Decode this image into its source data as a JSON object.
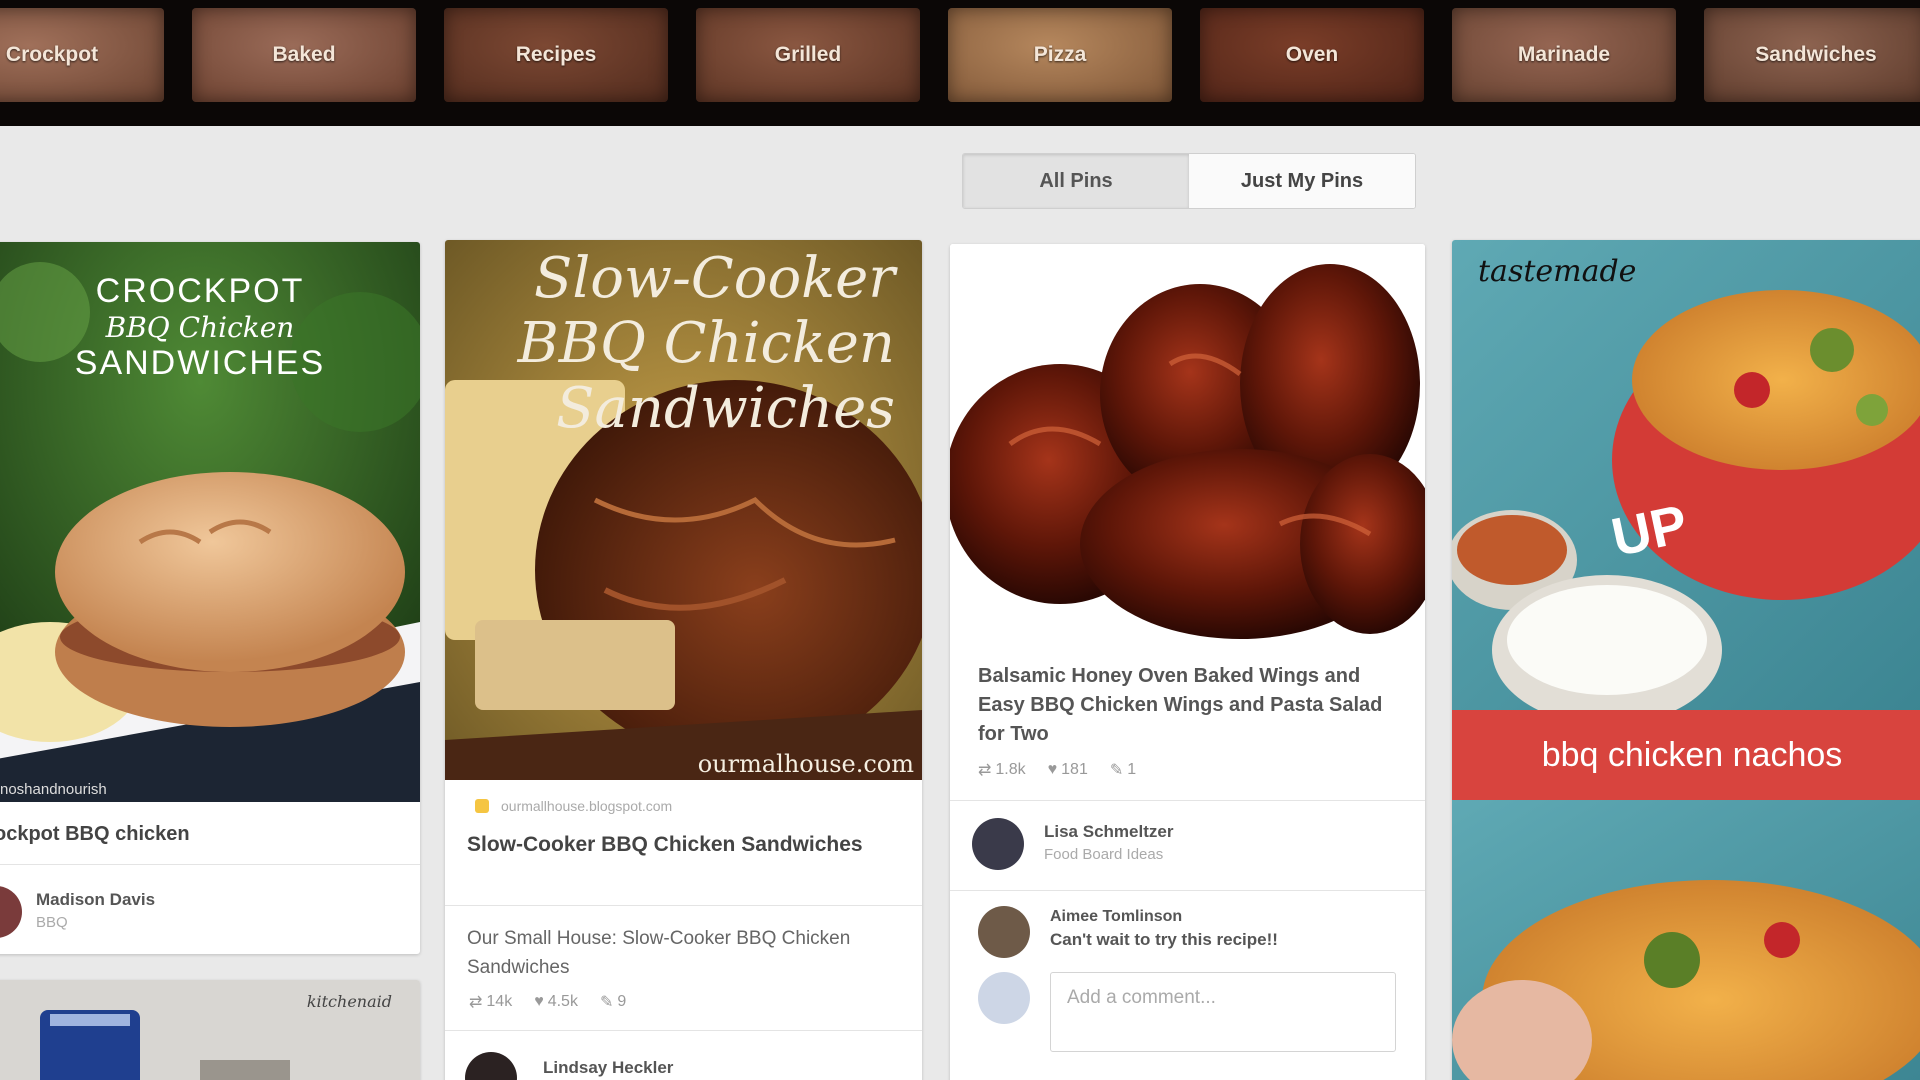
{
  "categories": [
    "Crockpot",
    "Baked",
    "Recipes",
    "Grilled",
    "Pizza",
    "Oven",
    "Marinade",
    "Sandwiches"
  ],
  "toggle": {
    "all": "All Pins",
    "mine": "Just My Pins"
  },
  "pins": [
    {
      "image_title_1": "CROCKPOT",
      "image_title_2": "BBQ Chicken",
      "image_title_3": "SANDWICHES",
      "watermark": "noshandnourish",
      "description": "ockpot BBQ chicken",
      "user_name": "Madison Davis",
      "user_sub": "BBQ"
    },
    {
      "image_title_1": "Slow-Cooker",
      "image_title_2": "BBQ Chicken",
      "image_title_3": "Sandwiches",
      "watermark": "ourmalhouse.com",
      "source": "ourmallhouse.blogspot.com",
      "title": "Slow-Cooker BBQ Chicken Sandwiches",
      "description": "Our Small House: Slow-Cooker BBQ Chicken Sandwiches",
      "stats": [
        "14k",
        "4.5k",
        "9"
      ],
      "user_name": "Lindsay Heckler"
    },
    {
      "description": "Balsamic Honey Oven Baked Wings and Easy BBQ Chicken Wings and Pasta Salad for Two",
      "stats": [
        "1.8k",
        "181",
        "1"
      ],
      "user_name": "Lisa Schmeltzer",
      "user_sub": "Food Board Ideas",
      "commenter_name": "Aimee Tomlinson",
      "comment": "Can't wait to try this recipe!!",
      "comment_placeholder": "Add a comment..."
    },
    {
      "brand": "tastemade",
      "bowl_text": "UP",
      "banner": "bbq chicken nachos"
    },
    {
      "watermark": "kitchenaid"
    }
  ]
}
